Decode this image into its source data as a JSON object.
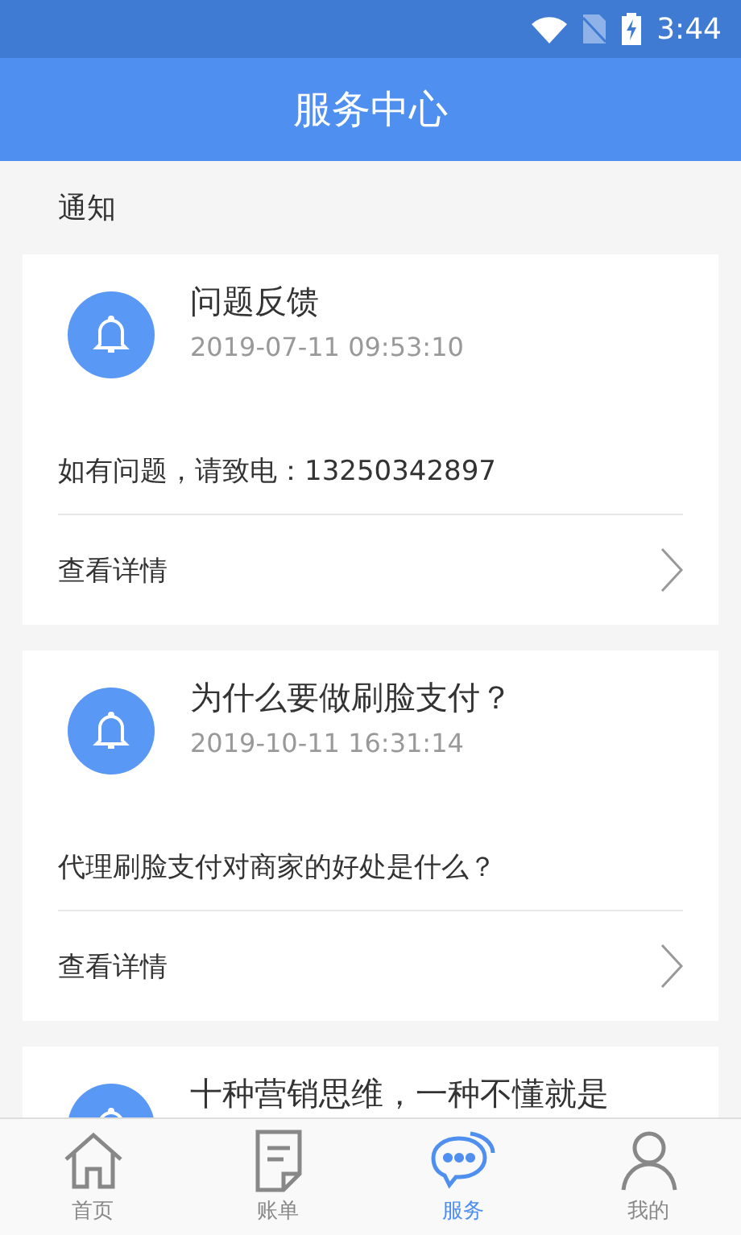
{
  "status_bar": {
    "time": "3:44"
  },
  "header": {
    "title": "服务中心"
  },
  "section_title": "通知",
  "notices": [
    {
      "title": "问题反馈",
      "date": "2019-07-11 09:53:10",
      "message": "如有问题，请致电：13250342897",
      "link": "查看详情"
    },
    {
      "title": "为什么要做刷脸支付？",
      "date": "2019-10-11 16:31:14",
      "message": "代理刷脸支付对商家的好处是什么？",
      "link": "查看详情"
    },
    {
      "title": "十种营销思维，一种不懂就是"
    }
  ],
  "tab_bar": [
    {
      "kind": "home",
      "label": "首页",
      "selected": false
    },
    {
      "kind": "bill",
      "label": "账单",
      "selected": false
    },
    {
      "kind": "service",
      "label": "服务",
      "selected": true
    },
    {
      "kind": "profile",
      "label": "我的",
      "selected": false
    }
  ]
}
